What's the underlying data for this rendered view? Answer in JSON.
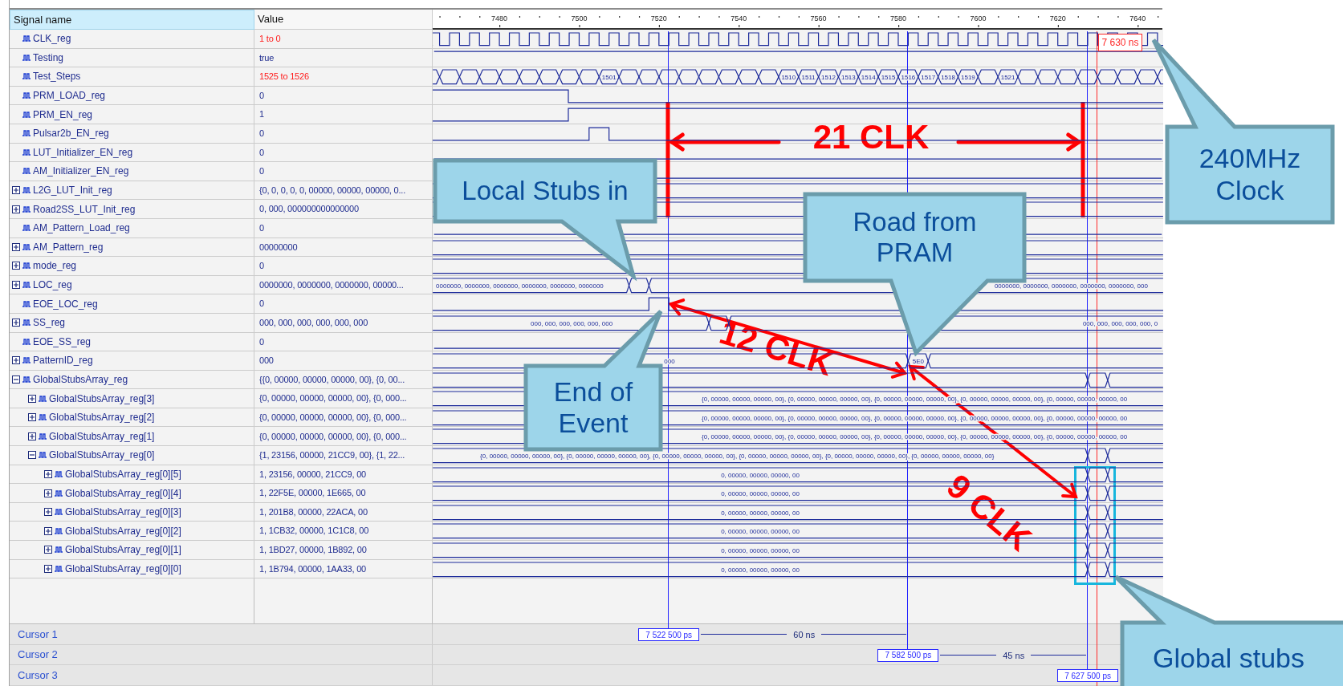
{
  "header": {
    "name": "Signal name",
    "value": "Value"
  },
  "timeline": {
    "ticks": [
      "7480",
      "7500",
      "7520",
      "7540",
      "7560",
      "7580",
      "7600",
      "7620",
      "7640"
    ],
    "marker": "7 630 ns"
  },
  "signals": [
    {
      "name": "CLK_reg",
      "value": "1 to 0",
      "changed": true
    },
    {
      "name": "Testing",
      "value": "true",
      "changed": false
    },
    {
      "name": "Test_Steps",
      "value": "1525 to 1526",
      "changed": true,
      "wave_labels": [
        "1501",
        "1510",
        "1511",
        "1512",
        "1513",
        "1514",
        "1515",
        "1516",
        "1517",
        "1518",
        "1519",
        "1521"
      ]
    },
    {
      "name": "PRM_LOAD_reg",
      "value": "0",
      "changed": false
    },
    {
      "name": "PRM_EN_reg",
      "value": "1",
      "changed": false
    },
    {
      "name": "Pulsar2b_EN_reg",
      "value": "0",
      "changed": false
    },
    {
      "name": "LUT_Initializer_EN_reg",
      "value": "0",
      "changed": false
    },
    {
      "name": "AM_Initializer_EN_reg",
      "value": "0",
      "changed": false
    },
    {
      "name": "L2G_LUT_Init_reg",
      "value": "{0, 0, 0, 0, 0, 00000, 00000, 00000, 0...",
      "changed": false,
      "expanded": false
    },
    {
      "name": "Road2SS_LUT_Init_reg",
      "value": "0, 000, 000000000000000",
      "changed": false,
      "expanded": false
    },
    {
      "name": "AM_Pattern_Load_reg",
      "value": "0",
      "changed": false
    },
    {
      "name": "AM_Pattern_reg",
      "value": "00000000",
      "changed": false,
      "expanded": false
    },
    {
      "name": "mode_reg",
      "value": "0",
      "changed": false,
      "expanded": false
    },
    {
      "name": "LOC_reg",
      "value": "0000000, 0000000, 0000000, 00000...",
      "changed": false,
      "expanded": false,
      "wave_labels": [
        "0000000, 0000000, 0000000, 0000000, 0000000, 0000000",
        "0000000, 0000000, 0000000, 0000000, 0000000, 000"
      ]
    },
    {
      "name": "EOE_LOC_reg",
      "value": "0",
      "changed": false
    },
    {
      "name": "SS_reg",
      "value": "000, 000, 000, 000, 000, 000",
      "changed": false,
      "expanded": false,
      "wave_labels": [
        "000, 000, 000, 000, 000, 000",
        "000, 000, 000, 000, 000, 0"
      ]
    },
    {
      "name": "EOE_SS_reg",
      "value": "0",
      "changed": false
    },
    {
      "name": "PatternID_reg",
      "value": "000",
      "changed": false,
      "expanded": false,
      "wave_labels": [
        "000",
        "5E0"
      ]
    },
    {
      "name": "GlobalStubsArray_reg",
      "value": "{{0, 00000, 00000, 00000, 00}, {0, 00...",
      "changed": false,
      "expanded": true,
      "children": [
        {
          "name": "GlobalStubsArray_reg[3]",
          "value": "{0, 00000, 00000, 00000, 00}, {0, 000...",
          "changed": false,
          "expanded": false,
          "wave_labels": [
            "{0, 00000, 00000, 00000, 00}, {0, 00000, 00000, 00000, 00}, {0, 00000, 00000, 00000, 00}, {0, 00000, 00000, 00000, 00}, {0, 00000, 00000, 00000, 00"
          ]
        },
        {
          "name": "GlobalStubsArray_reg[2]",
          "value": "{0, 00000, 00000, 00000, 00}, {0, 000...",
          "changed": false,
          "expanded": false,
          "wave_labels": [
            "{0, 00000, 00000, 00000, 00}, {0, 00000, 00000, 00000, 00}, {0, 00000, 00000, 00000, 00}, {0, 00000, 00000, 00000, 00}, {0, 00000, 00000, 00000, 00"
          ]
        },
        {
          "name": "GlobalStubsArray_reg[1]",
          "value": "{0, 00000, 00000, 00000, 00}, {0, 000...",
          "changed": false,
          "expanded": false,
          "wave_labels": [
            "{0, 00000, 00000, 00000, 00}, {0, 00000, 00000, 00000, 00}, {0, 00000, 00000, 00000, 00}, {0, 00000, 00000, 00000, 00}, {0, 00000, 00000, 00000, 00"
          ]
        },
        {
          "name": "GlobalStubsArray_reg[0]",
          "value": "{1, 23156, 00000, 21CC9, 00}, {1, 22...",
          "changed": false,
          "expanded": true,
          "wave_labels": [
            "{0, 00000, 00000, 00000, 00}, {0, 00000, 00000, 00000, 00}, {0, 00000, 00000, 00000, 00}, {0, 00000, 00000, 00000, 00}, {0, 00000, 00000, 00000, 00}, {0, 00000, 00000, 00000, 00}"
          ],
          "children": [
            {
              "name": "GlobalStubsArray_reg[0][5]",
              "value": "1, 23156, 00000, 21CC9, 00",
              "changed": false,
              "expanded": false,
              "wave_labels": [
                "0, 00000, 00000, 00000, 00"
              ]
            },
            {
              "name": "GlobalStubsArray_reg[0][4]",
              "value": "1, 22F5E, 00000, 1E665, 00",
              "changed": false,
              "expanded": false,
              "wave_labels": [
                "0, 00000, 00000, 00000, 00"
              ]
            },
            {
              "name": "GlobalStubsArray_reg[0][3]",
              "value": "1, 201B8, 00000, 22ACA, 00",
              "changed": false,
              "expanded": false,
              "wave_labels": [
                "0, 00000, 00000, 00000, 00"
              ]
            },
            {
              "name": "GlobalStubsArray_reg[0][2]",
              "value": "1, 1CB32, 00000, 1C1C8, 00",
              "changed": false,
              "expanded": false,
              "wave_labels": [
                "0, 00000, 00000, 00000, 00"
              ]
            },
            {
              "name": "GlobalStubsArray_reg[0][1]",
              "value": "1, 1BD27, 00000, 1B892, 00",
              "changed": false,
              "expanded": false,
              "wave_labels": [
                "0, 00000, 00000, 00000, 00"
              ]
            },
            {
              "name": "GlobalStubsArray_reg[0][0]",
              "value": "1, 1B794, 00000, 1AA33, 00",
              "changed": false,
              "expanded": false,
              "wave_labels": [
                "0, 00000, 00000, 00000, 00"
              ]
            }
          ]
        }
      ]
    }
  ],
  "cursors": [
    {
      "label": "Cursor 1",
      "time": "7 522 500 ps",
      "delta": "60 ns"
    },
    {
      "label": "Cursor 2",
      "time": "7 582 500 ps",
      "delta": "45 ns"
    },
    {
      "label": "Cursor 3",
      "time": "7 627 500 ps"
    }
  ],
  "callouts": [
    {
      "lines": [
        "Local Stubs in"
      ]
    },
    {
      "lines": [
        "Road from",
        "PRAM"
      ]
    },
    {
      "lines": [
        "End of",
        "Event"
      ]
    },
    {
      "lines": [
        "240MHz",
        "Clock"
      ]
    },
    {
      "lines": [
        "Global stubs"
      ]
    }
  ],
  "annotations": [
    {
      "text": "21 CLK"
    },
    {
      "text": "12 CLK"
    },
    {
      "text": "9 CLK"
    }
  ]
}
